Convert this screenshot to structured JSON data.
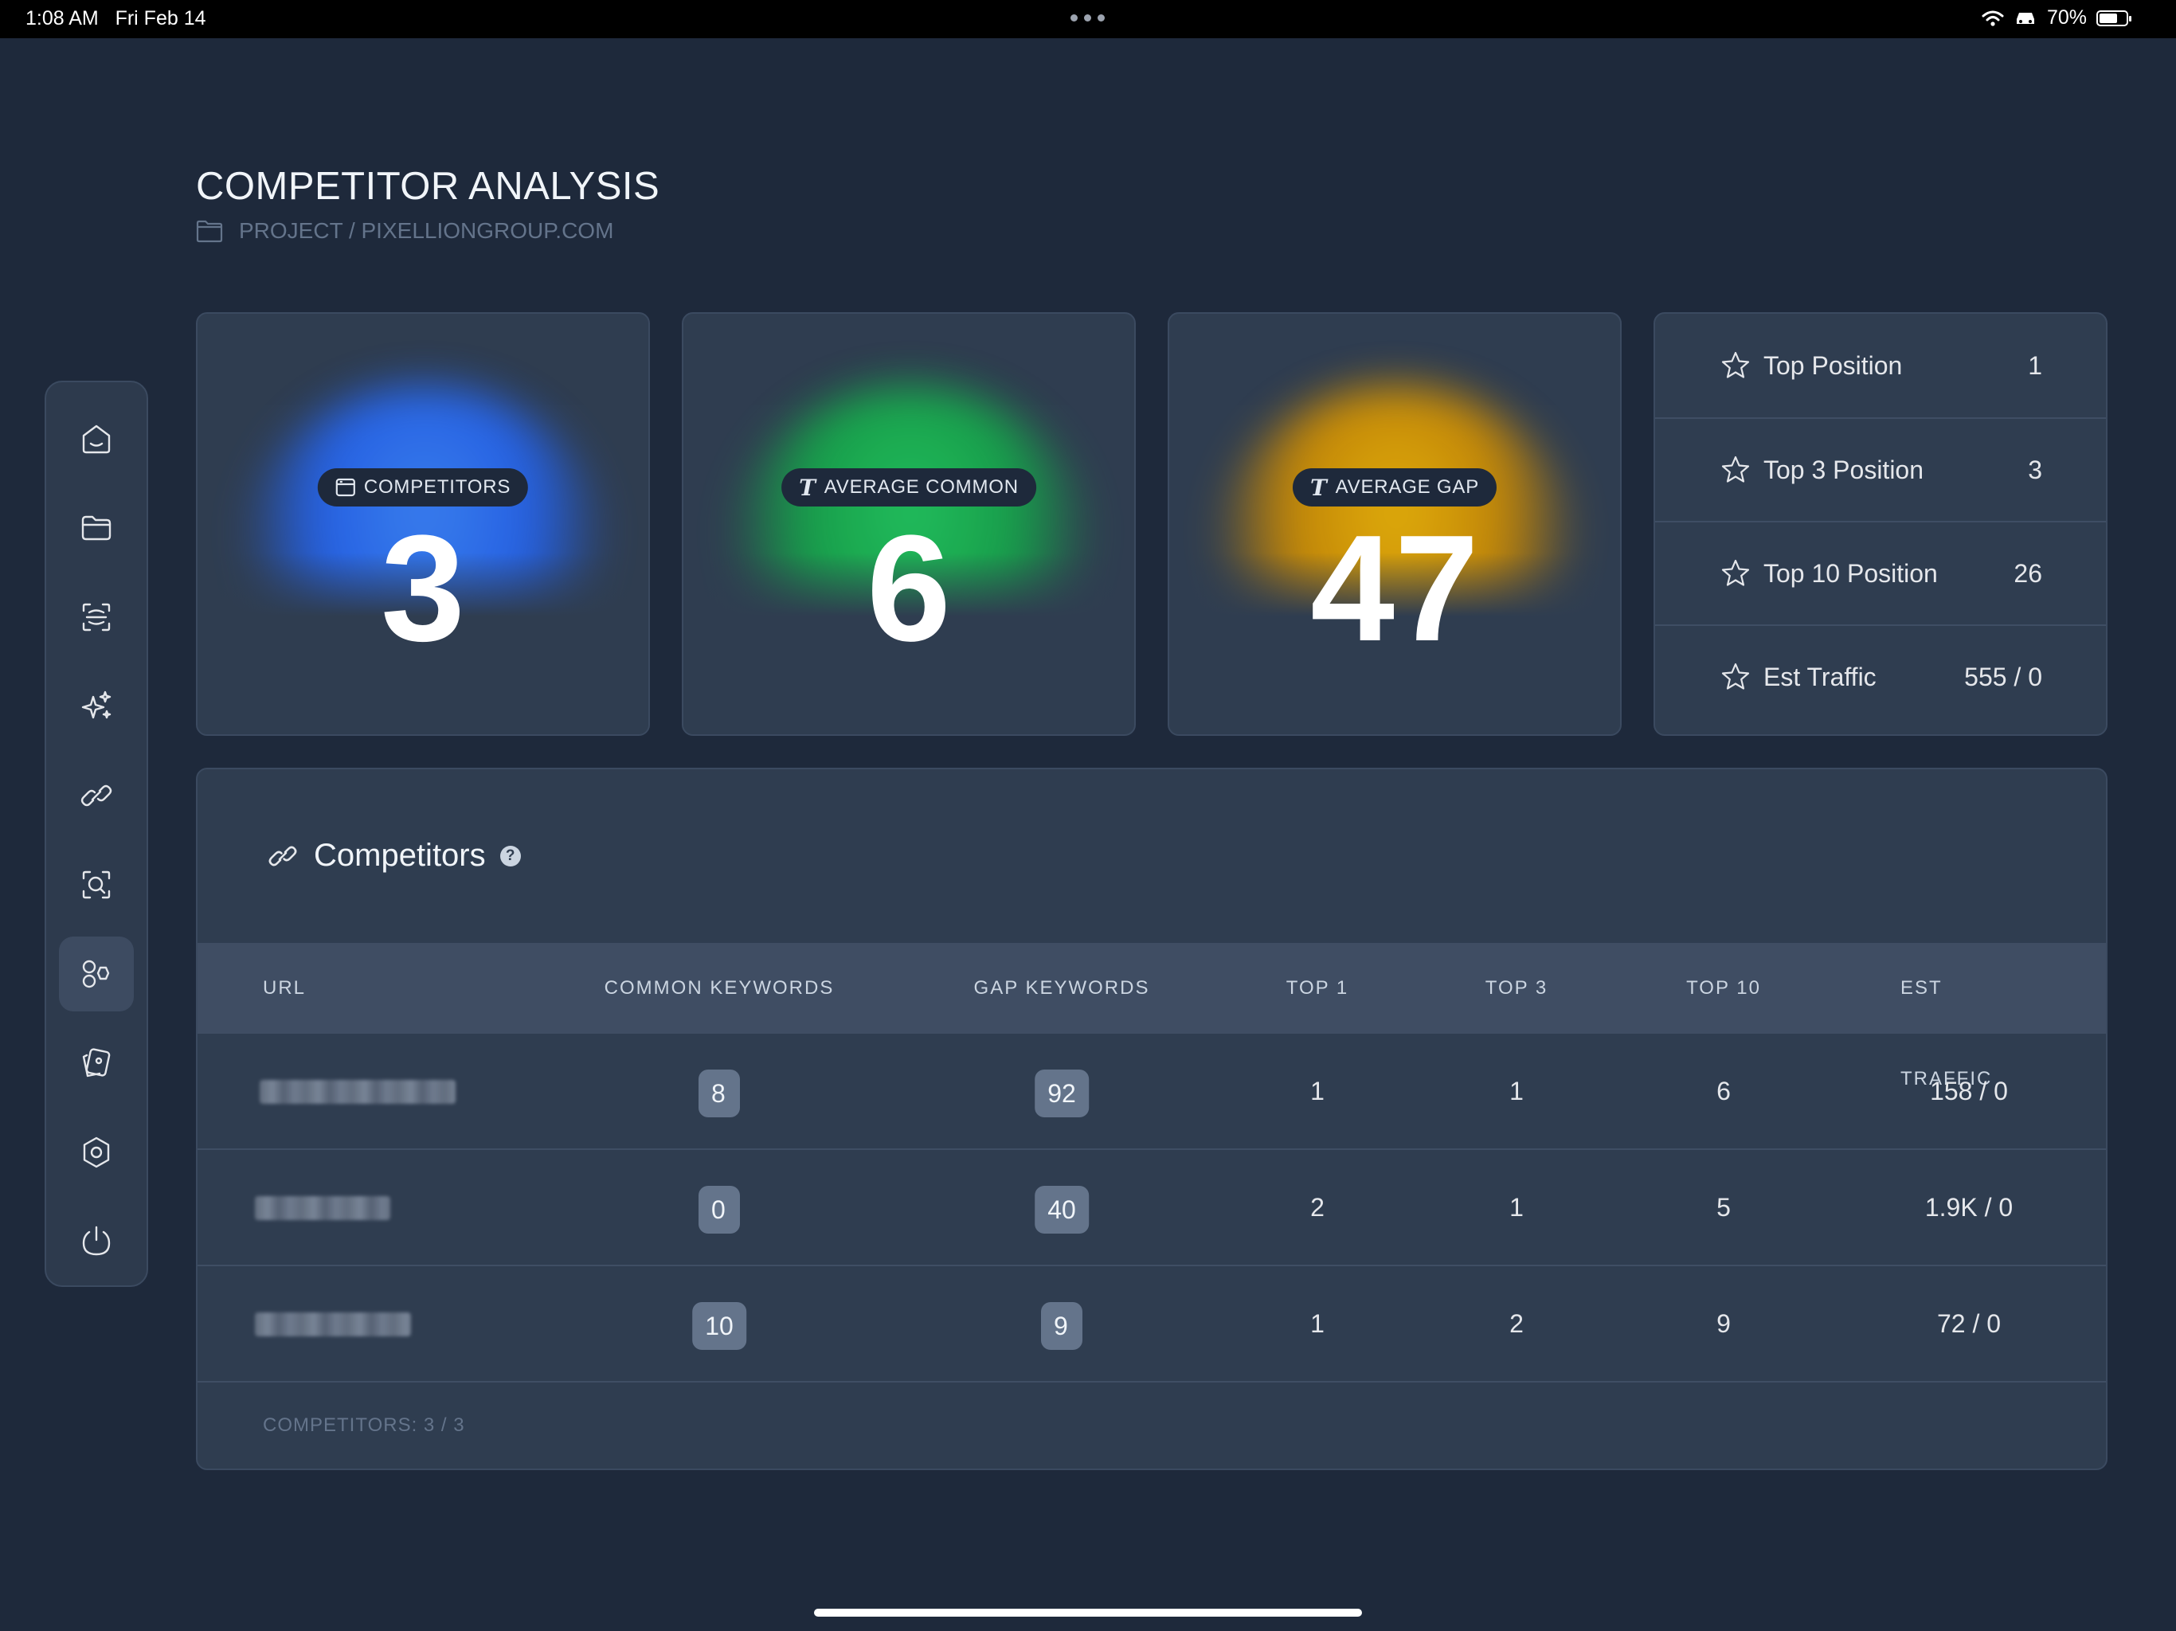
{
  "status_bar": {
    "time": "1:08 AM",
    "date": "Fri Feb 14",
    "battery": "70%",
    "battery_level": 0.7
  },
  "sidebar": {
    "items": [
      {
        "name": "home",
        "active": false
      },
      {
        "name": "folder",
        "active": false
      },
      {
        "name": "scan",
        "active": false
      },
      {
        "name": "sparkles",
        "active": false
      },
      {
        "name": "link",
        "active": false
      },
      {
        "name": "search",
        "active": false
      },
      {
        "name": "competitors",
        "active": true
      },
      {
        "name": "cards",
        "active": false
      },
      {
        "name": "settings",
        "active": false
      },
      {
        "name": "power",
        "active": false
      }
    ]
  },
  "header": {
    "title": "COMPETITOR ANALYSIS",
    "breadcrumb": "PROJECT / PIXELLIONGROUP.COM"
  },
  "stats": [
    {
      "label": "COMPETITORS",
      "value": "3",
      "color": "#3b82f6"
    },
    {
      "label": "AVERAGE COMMON",
      "value": "6",
      "color": "#22c55e"
    },
    {
      "label": "AVERAGE GAP",
      "value": "47",
      "color": "#eab308"
    }
  ],
  "summary": [
    {
      "label": "Top Position",
      "value": "1"
    },
    {
      "label": "Top 3 Position",
      "value": "3"
    },
    {
      "label": "Top 10 Position",
      "value": "26"
    },
    {
      "label": "Est Traffic",
      "value": "555 / 0"
    }
  ],
  "competitors_table": {
    "title": "Competitors",
    "help": "?",
    "columns": [
      "URL",
      "COMMON KEYWORDS",
      "GAP KEYWORDS",
      "TOP 1",
      "TOP 3",
      "TOP 10",
      "EST TRAFFIC"
    ],
    "rows": [
      {
        "common": "8",
        "gap": "92",
        "top1": "1",
        "top3": "1",
        "top10": "6",
        "traffic": "158 / 0"
      },
      {
        "common": "0",
        "gap": "40",
        "top1": "2",
        "top3": "1",
        "top10": "5",
        "traffic": "1.9K / 0"
      },
      {
        "common": "10",
        "gap": "9",
        "top1": "1",
        "top3": "2",
        "top10": "9",
        "traffic": "72 / 0"
      }
    ],
    "footer": "COMPETITORS: 3 / 3"
  }
}
